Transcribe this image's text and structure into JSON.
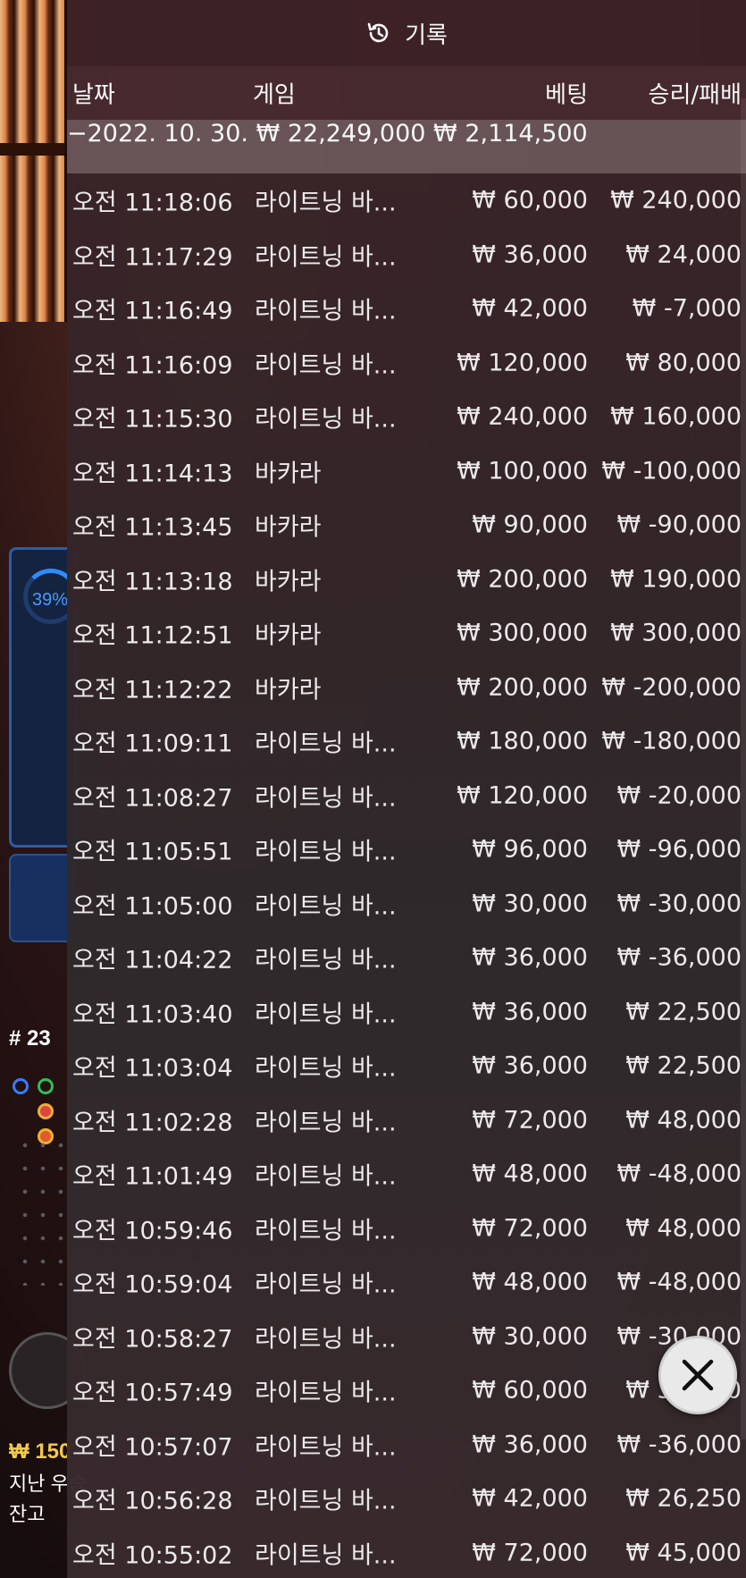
{
  "header": {
    "title": "기록",
    "icon": "history-icon"
  },
  "columns": {
    "date": "날짜",
    "game": "게임",
    "bet": "베팅",
    "result": "승리/패배"
  },
  "summary": {
    "date": "−2022. 10. 30.",
    "bet": "₩ 22,249,000",
    "result": "₩ 2,114,500"
  },
  "rows": [
    {
      "time": "오전 11:18:06",
      "game": "라이트닝 바...",
      "bet": "₩ 60,000",
      "result": "₩ 240,000"
    },
    {
      "time": "오전 11:17:29",
      "game": "라이트닝 바...",
      "bet": "₩ 36,000",
      "result": "₩ 24,000"
    },
    {
      "time": "오전 11:16:49",
      "game": "라이트닝 바...",
      "bet": "₩ 42,000",
      "result": "₩ -7,000"
    },
    {
      "time": "오전 11:16:09",
      "game": "라이트닝 바...",
      "bet": "₩ 120,000",
      "result": "₩ 80,000"
    },
    {
      "time": "오전 11:15:30",
      "game": "라이트닝 바...",
      "bet": "₩ 240,000",
      "result": "₩ 160,000"
    },
    {
      "time": "오전 11:14:13",
      "game": "바카라",
      "bet": "₩ 100,000",
      "result": "₩ -100,000"
    },
    {
      "time": "오전 11:13:45",
      "game": "바카라",
      "bet": "₩ 90,000",
      "result": "₩ -90,000"
    },
    {
      "time": "오전 11:13:18",
      "game": "바카라",
      "bet": "₩ 200,000",
      "result": "₩ 190,000"
    },
    {
      "time": "오전 11:12:51",
      "game": "바카라",
      "bet": "₩ 300,000",
      "result": "₩ 300,000"
    },
    {
      "time": "오전 11:12:22",
      "game": "바카라",
      "bet": "₩ 200,000",
      "result": "₩ -200,000"
    },
    {
      "time": "오전 11:09:11",
      "game": "라이트닝 바...",
      "bet": "₩ 180,000",
      "result": "₩ -180,000"
    },
    {
      "time": "오전 11:08:27",
      "game": "라이트닝 바...",
      "bet": "₩ 120,000",
      "result": "₩ -20,000"
    },
    {
      "time": "오전 11:05:51",
      "game": "라이트닝 바...",
      "bet": "₩ 96,000",
      "result": "₩ -96,000"
    },
    {
      "time": "오전 11:05:00",
      "game": "라이트닝 바...",
      "bet": "₩ 30,000",
      "result": "₩ -30,000"
    },
    {
      "time": "오전 11:04:22",
      "game": "라이트닝 바...",
      "bet": "₩ 36,000",
      "result": "₩ -36,000"
    },
    {
      "time": "오전 11:03:40",
      "game": "라이트닝 바...",
      "bet": "₩ 36,000",
      "result": "₩ 22,500"
    },
    {
      "time": "오전 11:03:04",
      "game": "라이트닝 바...",
      "bet": "₩ 36,000",
      "result": "₩ 22,500"
    },
    {
      "time": "오전 11:02:28",
      "game": "라이트닝 바...",
      "bet": "₩ 72,000",
      "result": "₩ 48,000"
    },
    {
      "time": "오전 11:01:49",
      "game": "라이트닝 바...",
      "bet": "₩ 48,000",
      "result": "₩ -48,000"
    },
    {
      "time": "오전 10:59:46",
      "game": "라이트닝 바...",
      "bet": "₩ 72,000",
      "result": "₩ 48,000"
    },
    {
      "time": "오전 10:59:04",
      "game": "라이트닝 바...",
      "bet": "₩ 48,000",
      "result": "₩ -48,000"
    },
    {
      "time": "오전 10:58:27",
      "game": "라이트닝 바...",
      "bet": "₩ 30,000",
      "result": "₩ -30,000"
    },
    {
      "time": "오전 10:57:49",
      "game": "라이트닝 바...",
      "bet": "₩ 60,000",
      "result": "₩ 37,500"
    },
    {
      "time": "오전 10:57:07",
      "game": "라이트닝 바...",
      "bet": "₩ 36,000",
      "result": "₩ -36,000"
    },
    {
      "time": "오전 10:56:28",
      "game": "라이트닝 바...",
      "bet": "₩ 42,000",
      "result": "₩ 26,250"
    },
    {
      "time": "오전 10:55:02",
      "game": "라이트닝 바...",
      "bet": "₩ 72,000",
      "result": "₩ 45,000"
    }
  ],
  "background": {
    "stat_percent": "39%",
    "round_label": "# 23",
    "balance_amount": "₩ 150",
    "last_win_label": "지난 우승",
    "balance_label": "잔고",
    "accent_gold": "#f2c94c",
    "accent_blue": "#2f8cff"
  },
  "close_button": {
    "icon": "close-icon"
  }
}
